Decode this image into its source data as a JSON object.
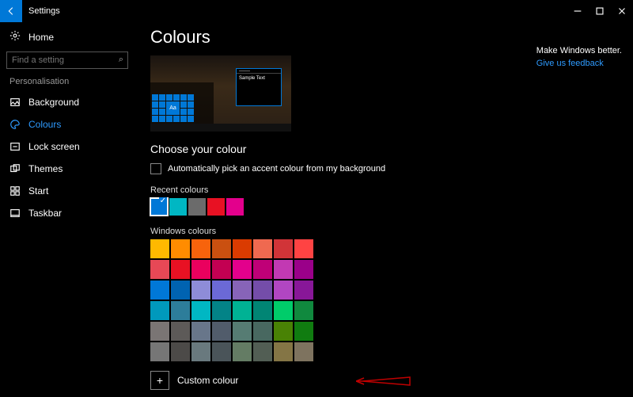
{
  "titlebar": {
    "app": "Settings"
  },
  "sidebar": {
    "home": "Home",
    "search_placeholder": "Find a setting",
    "category": "Personalisation",
    "items": [
      {
        "label": "Background"
      },
      {
        "label": "Colours"
      },
      {
        "label": "Lock screen"
      },
      {
        "label": "Themes"
      },
      {
        "label": "Start"
      },
      {
        "label": "Taskbar"
      }
    ]
  },
  "page": {
    "title": "Colours",
    "preview_sample": "Sample Text",
    "preview_aa": "Aa",
    "section": "Choose your colour",
    "auto_pick": "Automatically pick an accent colour from my background",
    "recent_label": "Recent colours",
    "recent": [
      "#0078d7",
      "#00b7c3",
      "#6b6b6b",
      "#e81123",
      "#e3008c"
    ],
    "windows_label": "Windows colours",
    "windows": [
      "#ffb900",
      "#ff8c00",
      "#f7630c",
      "#ca5010",
      "#da3b01",
      "#ef6950",
      "#d13438",
      "#ff4343",
      "#e74856",
      "#e81123",
      "#ea005e",
      "#c30052",
      "#e3008c",
      "#bf0077",
      "#c239b3",
      "#9a0089",
      "#0078d7",
      "#0063b1",
      "#8e8cd8",
      "#6b69d6",
      "#8764b8",
      "#744da9",
      "#b146c2",
      "#881798",
      "#0099bc",
      "#2d7d9a",
      "#00b7c3",
      "#038387",
      "#00b294",
      "#018574",
      "#00cc6a",
      "#10893e",
      "#7a7574",
      "#5d5a58",
      "#68768a",
      "#515c6b",
      "#567c73",
      "#486860",
      "#498205",
      "#107c10",
      "#767676",
      "#4c4a48",
      "#69797e",
      "#4a5459",
      "#647c64",
      "#525e54",
      "#847545",
      "#7e735f"
    ],
    "custom": "Custom colour"
  },
  "right": {
    "head": "Make Windows better.",
    "link": "Give us feedback"
  }
}
